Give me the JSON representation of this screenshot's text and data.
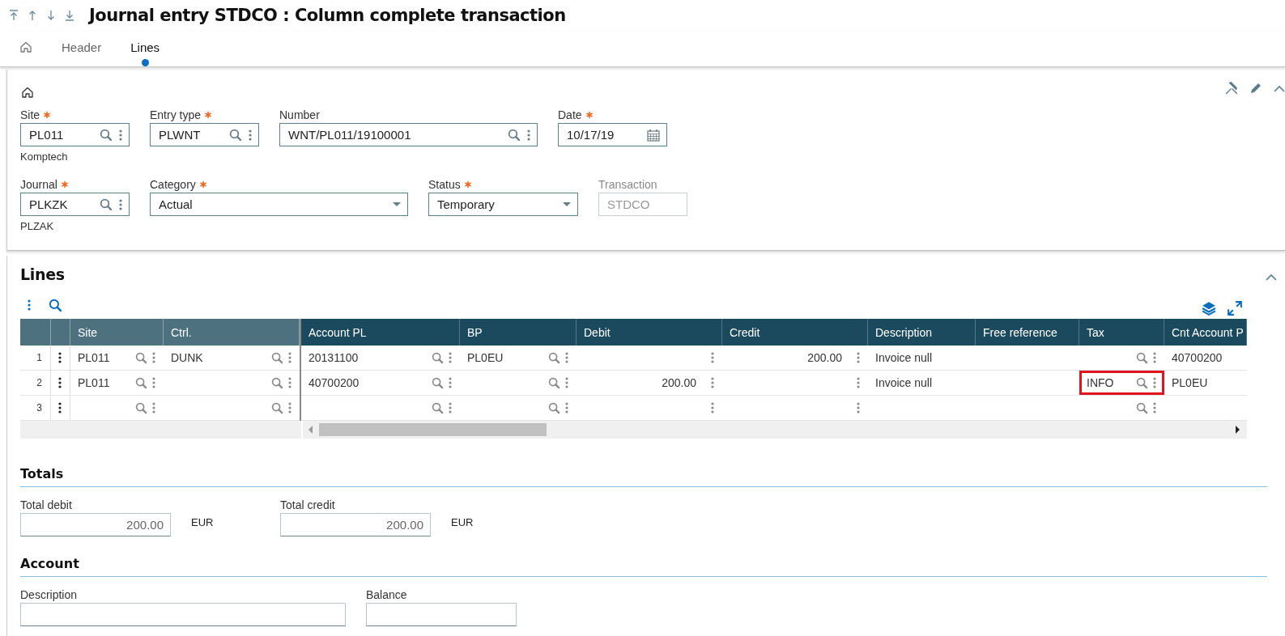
{
  "toolbar": {
    "title": "Journal entry STDCO : Column complete transaction"
  },
  "tabs": [
    {
      "kind": "home",
      "selected": false
    },
    {
      "kind": "text",
      "label": "Header",
      "selected": false
    },
    {
      "kind": "text",
      "label": "Lines",
      "selected": true
    }
  ],
  "header_panel": {
    "rows": [
      [
        {
          "label": "Site",
          "required": true,
          "kind": "lookup",
          "value": "PL011",
          "caption": "Komptech"
        },
        {
          "label": "Entry type",
          "required": true,
          "kind": "lookup",
          "value": "PLWNT"
        },
        {
          "label": "Number",
          "required": false,
          "kind": "lookup",
          "value": "WNT/PL011/19100001"
        },
        {
          "label": "Date",
          "required": true,
          "kind": "date",
          "value": "10/17/19"
        }
      ],
      [
        {
          "label": "Journal",
          "required": true,
          "kind": "lookup",
          "value": "PLKZK",
          "caption": "PLZAK"
        },
        {
          "label": "Category",
          "required": true,
          "kind": "select",
          "value": "Actual"
        },
        {
          "label": "Status",
          "required": true,
          "kind": "select",
          "value": "Temporary"
        },
        {
          "label": "Transaction",
          "required": false,
          "kind": "readonly",
          "value": "STDCO"
        }
      ]
    ]
  },
  "lines": {
    "title": "Lines",
    "columns": [
      {
        "label": "Site",
        "kind": "lookup",
        "frozen": true
      },
      {
        "label": "Ctrl.",
        "kind": "lookup",
        "frozen": true
      },
      {
        "label": "Account PL",
        "kind": "lookup",
        "frozen": false
      },
      {
        "label": "BP",
        "kind": "lookup",
        "frozen": false
      },
      {
        "label": "Debit",
        "kind": "amount",
        "frozen": false
      },
      {
        "label": "Credit",
        "kind": "amount",
        "frozen": false
      },
      {
        "label": "Description",
        "kind": "text",
        "frozen": false
      },
      {
        "label": "Free reference",
        "kind": "text",
        "frozen": false
      },
      {
        "label": "Tax",
        "kind": "lookup",
        "frozen": false
      },
      {
        "label": "Cnt Account P",
        "kind": "text",
        "frozen": false
      }
    ],
    "rows": [
      {
        "number": "1",
        "cells": [
          {
            "text": "PL011",
            "highlighted": false
          },
          {
            "text": "DUNK",
            "highlighted": false
          },
          {
            "text": "20131100",
            "highlighted": false
          },
          {
            "text": "PL0EU",
            "highlighted": false
          },
          {
            "highlighted": false
          },
          {
            "text": "200.00",
            "highlighted": false
          },
          {
            "text": "Invoice null",
            "highlighted": false
          },
          {
            "highlighted": false
          },
          {
            "highlighted": false
          },
          {
            "text": "40700200",
            "highlighted": false
          }
        ]
      },
      {
        "number": "2",
        "cells": [
          {
            "text": "PL011",
            "highlighted": false
          },
          {
            "highlighted": false
          },
          {
            "text": "40700200",
            "highlighted": false
          },
          {
            "highlighted": false
          },
          {
            "text": "200.00",
            "highlighted": false
          },
          {
            "highlighted": false
          },
          {
            "text": "Invoice null",
            "highlighted": false
          },
          {
            "highlighted": false
          },
          {
            "text": "INFO",
            "highlighted": true
          },
          {
            "text": "PL0EU",
            "highlighted": false
          }
        ]
      },
      {
        "number": "3",
        "cells": [
          {
            "highlighted": false
          },
          {
            "highlighted": false
          },
          {
            "highlighted": false
          },
          {
            "highlighted": false
          },
          {
            "highlighted": false
          },
          {
            "highlighted": false
          },
          {
            "highlighted": false
          },
          {
            "highlighted": false
          },
          {
            "highlighted": false
          },
          {
            "highlighted": false
          }
        ]
      }
    ]
  },
  "totals": {
    "title": "Totals",
    "fields": [
      {
        "label": "Total debit",
        "value": "200.00",
        "unit": "EUR"
      },
      {
        "label": "Total credit",
        "value": "200.00",
        "unit": "EUR"
      }
    ]
  },
  "account": {
    "title": "Account",
    "fields": [
      {
        "label": "Description"
      },
      {
        "label": "Balance"
      }
    ]
  }
}
